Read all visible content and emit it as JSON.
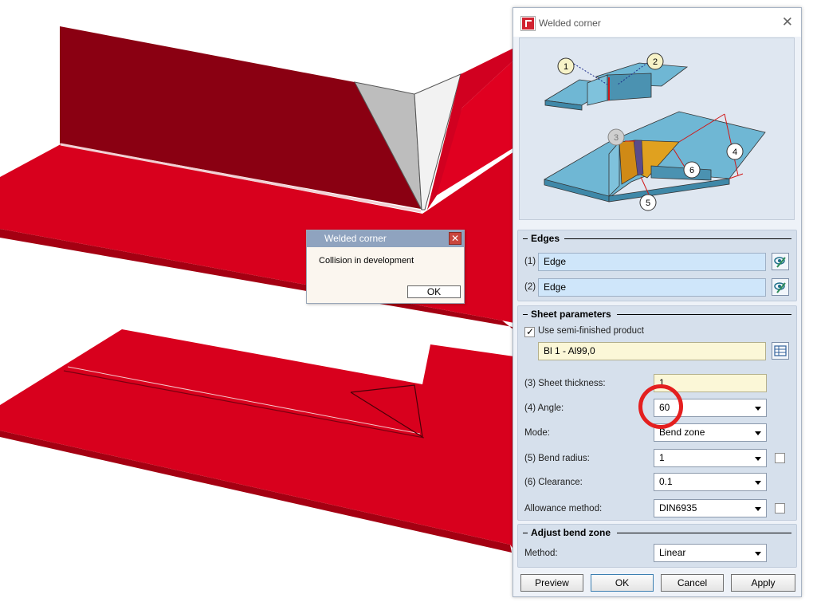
{
  "popup": {
    "title": "Welded corner",
    "message": "Collision in development",
    "ok_label": "OK"
  },
  "dialog": {
    "title": "Welded corner",
    "preview_callouts": [
      "1",
      "2",
      "3",
      "4",
      "5",
      "6"
    ],
    "edges": {
      "title": "Edges",
      "items": [
        {
          "label": "(1)",
          "value": "Edge"
        },
        {
          "label": "(2)",
          "value": "Edge"
        }
      ]
    },
    "sheet": {
      "title": "Sheet parameters",
      "semi_finished_label": "Use semi-finished product",
      "semi_finished_checked": true,
      "material": "Bl 1 - Al99,0",
      "thickness_label": "(3) Sheet thickness:",
      "thickness_value": "1",
      "angle_label": "(4) Angle:",
      "angle_value": "60",
      "mode_label": "Mode:",
      "mode_value": "Bend zone",
      "bend_radius_label": "(5) Bend radius:",
      "bend_radius_value": "1",
      "clearance_label": "(6) Clearance:",
      "clearance_value": "0.1",
      "allowance_label": "Allowance method:",
      "allowance_value": "DIN6935"
    },
    "adjust": {
      "title": "Adjust bend zone",
      "method_label": "Method:",
      "method_value": "Linear"
    },
    "buttons": {
      "preview": "Preview",
      "ok": "OK",
      "cancel": "Cancel",
      "apply": "Apply"
    }
  },
  "colors": {
    "sheet_red": "#d8001d",
    "wall_dark": "#8a0012",
    "highlight": "#e41f1f",
    "field_blue": "#cfe6fa",
    "field_yellow": "#fbf7d7"
  }
}
